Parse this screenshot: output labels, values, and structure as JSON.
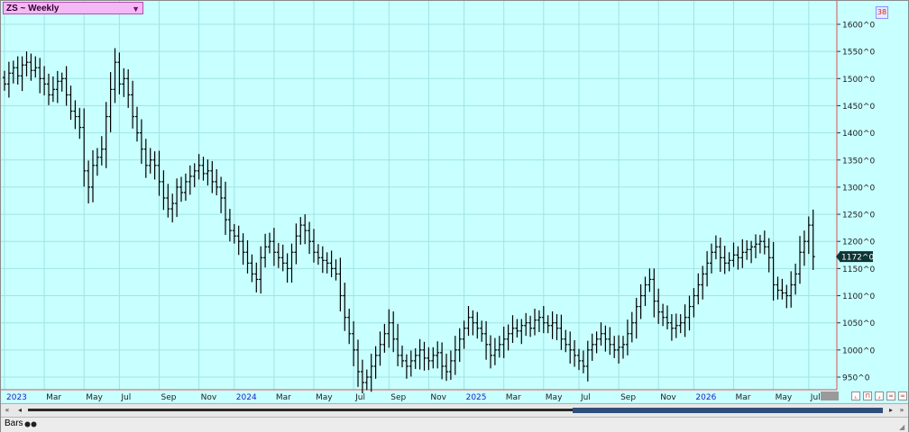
{
  "window": {
    "title": "ZS ~ Weekly",
    "corner_badge": "38",
    "bars_label": "Bars"
  },
  "colors": {
    "background": "#c8ffff",
    "grid": "#a0e4e4",
    "price_bars": "#000000",
    "last_price_tag": "#0f3535",
    "title_box": "#f4b8f4"
  },
  "chart_data": {
    "type": "ohlc",
    "title": "ZS ~ Weekly",
    "xlabel": "",
    "ylabel": "",
    "ylim": [
      925,
      1640
    ],
    "grid": true,
    "y_ticks": [
      950,
      1000,
      1050,
      1100,
      1150,
      1200,
      1250,
      1300,
      1350,
      1400,
      1450,
      1500,
      1550,
      1600
    ],
    "y_tick_labels": [
      "950^0",
      "1000^0",
      "1050^0",
      "1100^0",
      "1150^0",
      "1200^0",
      "1250^0",
      "1300^0",
      "1350^0",
      "1400^0",
      "1450^0",
      "1500^0",
      "1550^0",
      "1600^0"
    ],
    "x_labels": [
      {
        "label": "2023",
        "year": true,
        "week": 0
      },
      {
        "label": "Mar",
        "year": false,
        "week": 9
      },
      {
        "label": "May",
        "year": false,
        "week": 18
      },
      {
        "label": "Jul",
        "year": false,
        "week": 26
      },
      {
        "label": "Sep",
        "year": false,
        "week": 35
      },
      {
        "label": "Nov",
        "year": false,
        "week": 44
      },
      {
        "label": "2024",
        "year": true,
        "week": 52
      },
      {
        "label": "Mar",
        "year": false,
        "week": 61
      },
      {
        "label": "May",
        "year": false,
        "week": 70
      },
      {
        "label": "Jul",
        "year": false,
        "week": 79
      },
      {
        "label": "Sep",
        "year": false,
        "week": 87
      },
      {
        "label": "Nov",
        "year": false,
        "week": 96
      },
      {
        "label": "2025",
        "year": true,
        "week": 104
      },
      {
        "label": "Mar",
        "year": false,
        "week": 113
      },
      {
        "label": "May",
        "year": false,
        "week": 122
      },
      {
        "label": "Jul",
        "year": false,
        "week": 130
      },
      {
        "label": "Sep",
        "year": false,
        "week": 139
      },
      {
        "label": "Nov",
        "year": false,
        "week": 148
      },
      {
        "label": "2026",
        "year": true,
        "week": 156
      },
      {
        "label": "Mar",
        "year": false,
        "week": 165
      },
      {
        "label": "May",
        "year": false,
        "week": 174
      },
      {
        "label": "Jul",
        "year": false,
        "week": 182
      }
    ],
    "last_price": 1172,
    "last_price_label": "1172^0",
    "closes": [
      1490,
      1510,
      1520,
      1505,
      1525,
      1530,
      1515,
      1520,
      1500,
      1490,
      1470,
      1480,
      1495,
      1500,
      1470,
      1440,
      1430,
      1410,
      1330,
      1300,
      1340,
      1355,
      1370,
      1430,
      1480,
      1530,
      1490,
      1500,
      1470,
      1430,
      1400,
      1370,
      1340,
      1350,
      1340,
      1310,
      1280,
      1260,
      1270,
      1300,
      1290,
      1310,
      1320,
      1330,
      1340,
      1325,
      1330,
      1310,
      1300,
      1280,
      1240,
      1220,
      1210,
      1200,
      1180,
      1160,
      1140,
      1130,
      1170,
      1190,
      1200,
      1180,
      1170,
      1160,
      1150,
      1180,
      1210,
      1230,
      1220,
      1200,
      1180,
      1170,
      1165,
      1160,
      1150,
      1140,
      1100,
      1060,
      1030,
      1000,
      960,
      940,
      950,
      970,
      990,
      1010,
      1030,
      1050,
      1020,
      990,
      980,
      970,
      980,
      990,
      1000,
      985,
      980,
      990,
      995,
      970,
      960,
      980,
      1000,
      1020,
      1040,
      1060,
      1050,
      1040,
      1030,
      1010,
      990,
      1000,
      1010,
      1020,
      1030,
      1040,
      1035,
      1045,
      1050,
      1040,
      1055,
      1060,
      1050,
      1045,
      1050,
      1040,
      1020,
      1010,
      1000,
      990,
      980,
      970,
      1000,
      1010,
      1020,
      1030,
      1020,
      1010,
      1000,
      1005,
      1010,
      1030,
      1050,
      1080,
      1100,
      1120,
      1130,
      1090,
      1070,
      1060,
      1050,
      1040,
      1045,
      1050,
      1060,
      1080,
      1100,
      1120,
      1140,
      1160,
      1180,
      1190,
      1170,
      1160,
      1165,
      1175,
      1170,
      1180,
      1185,
      1190,
      1195,
      1200,
      1190,
      1170,
      1120,
      1110,
      1105,
      1100,
      1120,
      1140,
      1180,
      1200,
      1230,
      1172
    ]
  }
}
